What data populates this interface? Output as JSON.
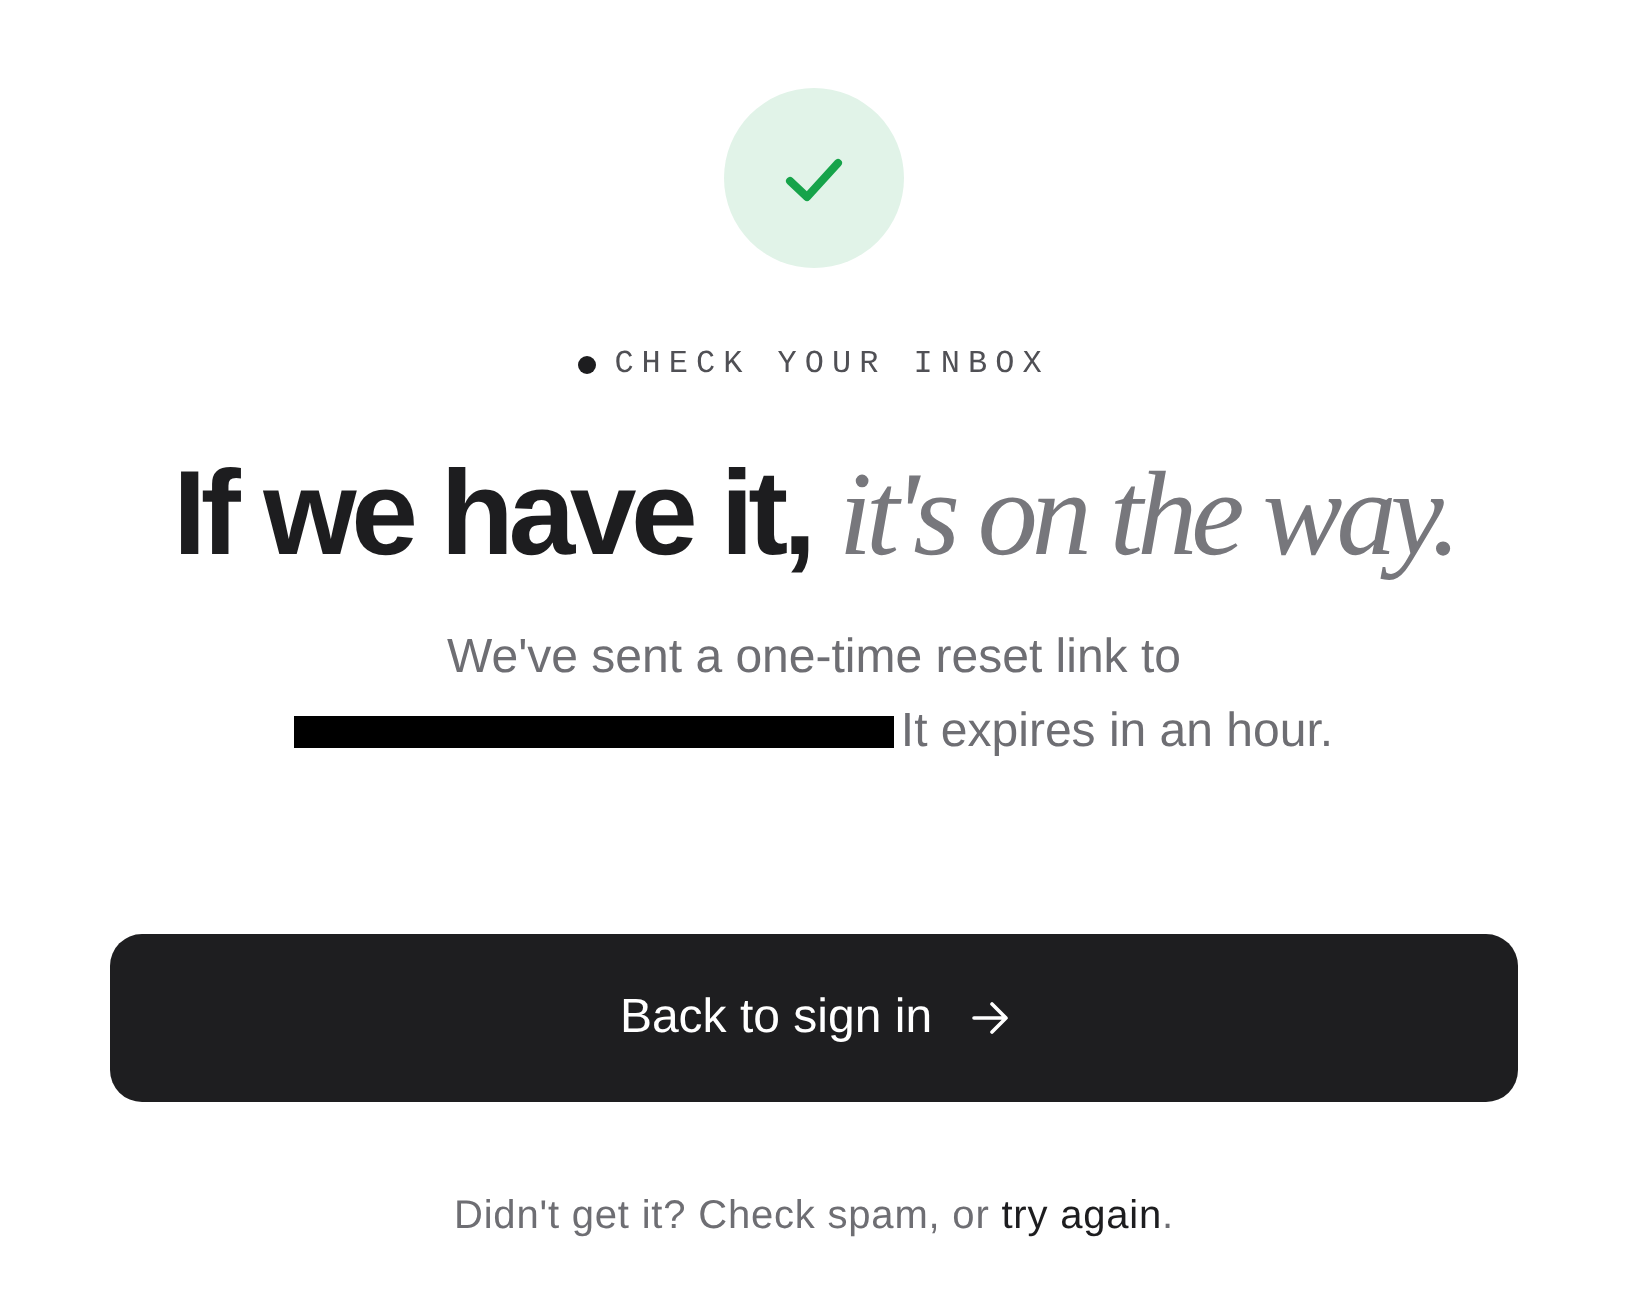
{
  "status_icon": {
    "kind": "success"
  },
  "eyebrow": {
    "text": "CHECK YOUR INBOX"
  },
  "headline": "If we have it, *it's on the way.*",
  "message": {
    "before_email": "We've sent a one-time reset link to",
    "email_redacted": true,
    "after_email": "It expires in an hour."
  },
  "primary_button": {
    "label": "Back to sign in"
  },
  "footer": {
    "text": "Didn't get it? Check spam, or ",
    "link": "try again",
    "after": "."
  }
}
